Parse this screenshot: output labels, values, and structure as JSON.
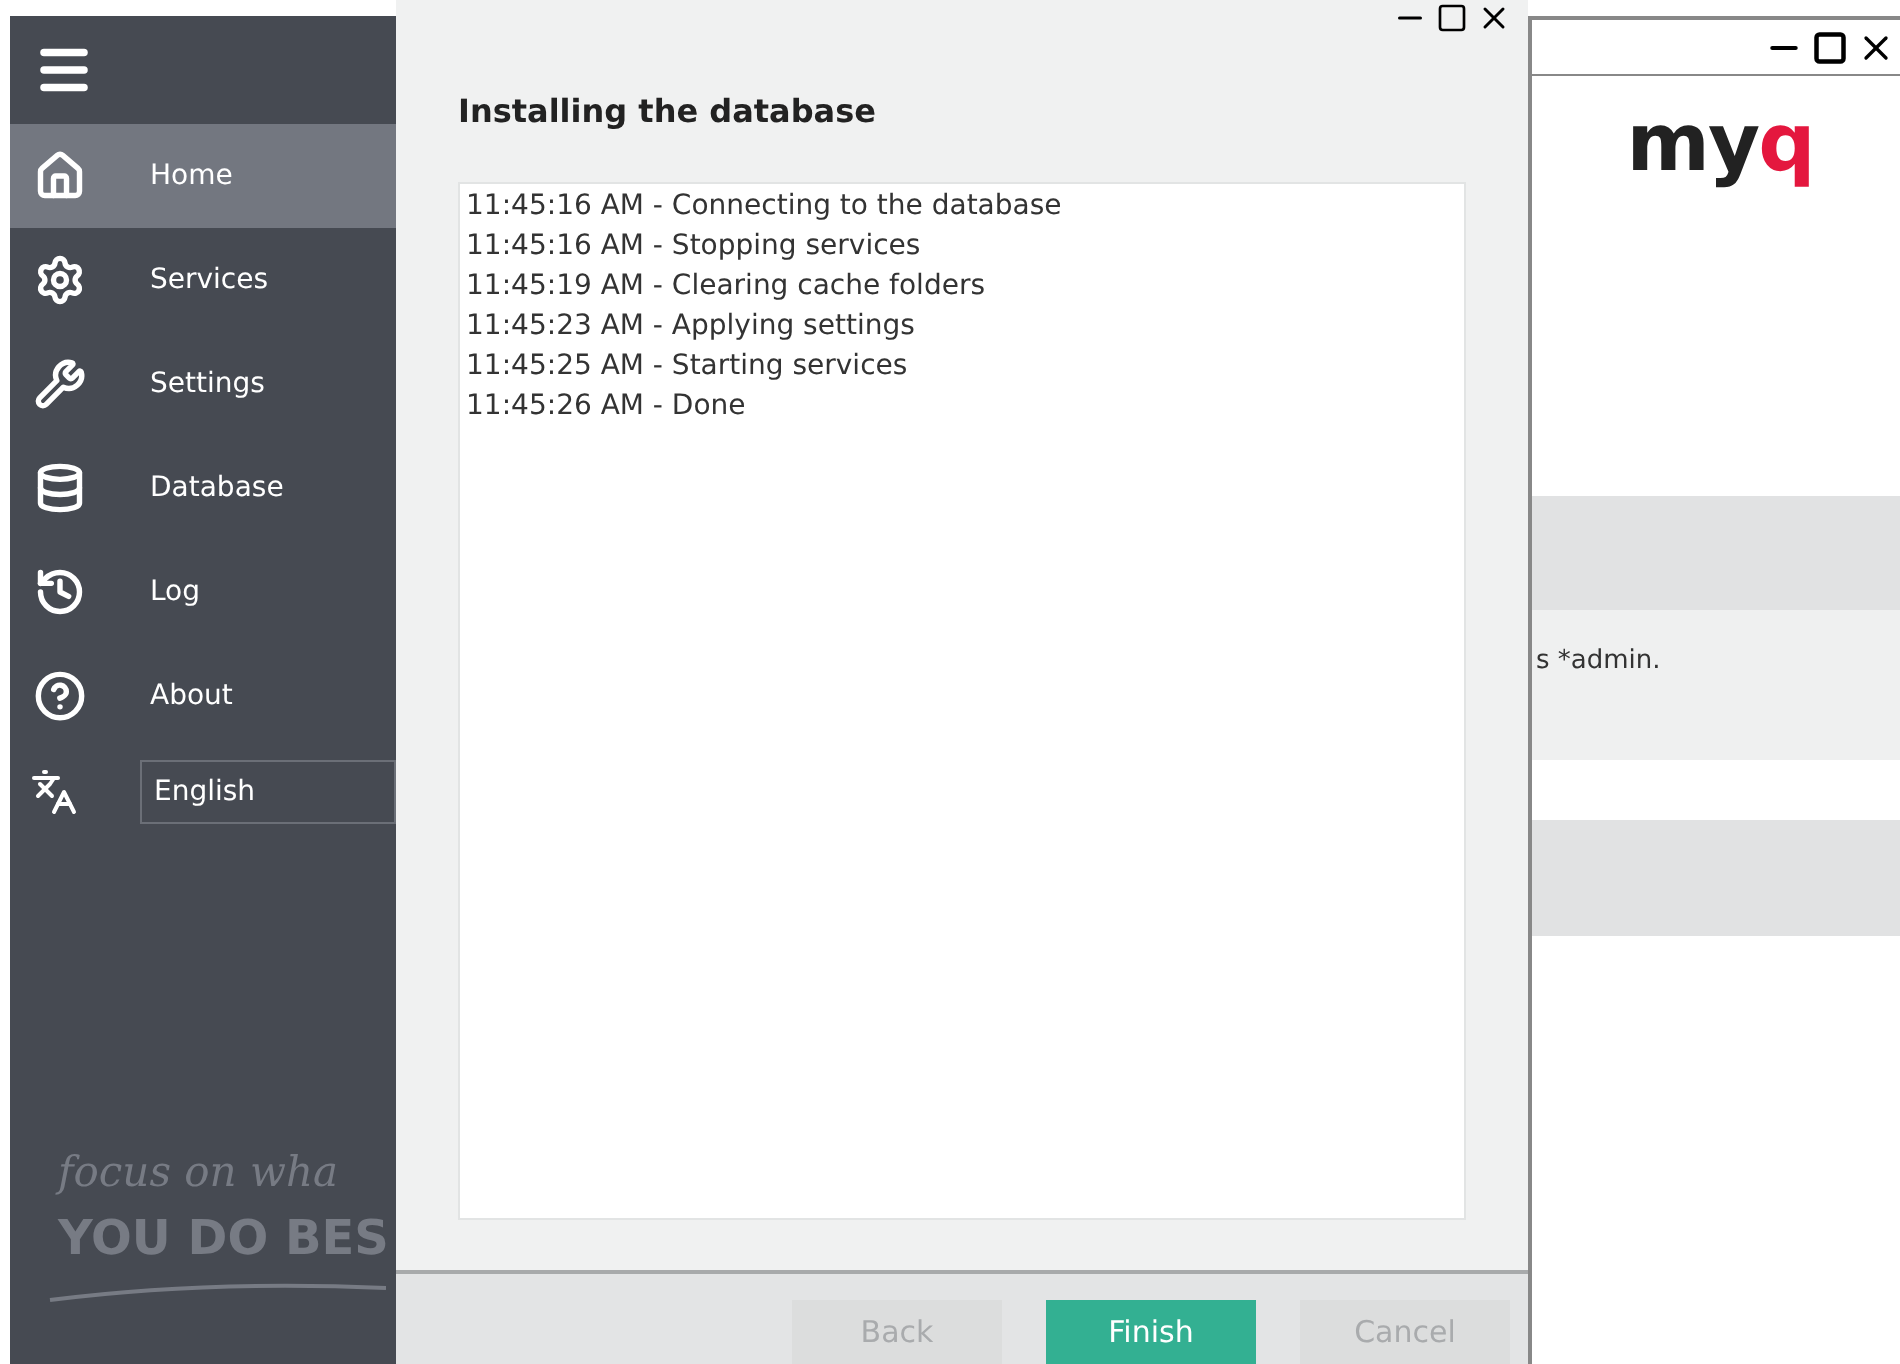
{
  "sidebar": {
    "items": [
      {
        "label": "Home",
        "selected": true
      },
      {
        "label": "Services",
        "selected": false
      },
      {
        "label": "Settings",
        "selected": false
      },
      {
        "label": "Database",
        "selected": false
      },
      {
        "label": "Log",
        "selected": false
      },
      {
        "label": "About",
        "selected": false
      }
    ],
    "language": {
      "value": "English"
    },
    "tagline": {
      "line_1": "focus on wha",
      "line_2": "YOU DO BES"
    }
  },
  "dialog": {
    "title": "Installing the database",
    "log_lines": [
      "11:45:16 AM - Connecting to the database",
      "11:45:16 AM - Stopping services",
      "11:45:19 AM - Clearing cache folders",
      "11:45:23 AM - Applying settings",
      "11:45:25 AM - Starting services",
      "11:45:26 AM - Done"
    ],
    "buttons": [
      {
        "label": "Back",
        "kind": "secondary",
        "disabled": true
      },
      {
        "label": "Finish",
        "kind": "primary",
        "disabled": false
      },
      {
        "label": "Cancel",
        "kind": "secondary",
        "disabled": true
      }
    ]
  },
  "background_window": {
    "logo": {
      "part_1": "my",
      "part_2": "q"
    },
    "message": "s *admin."
  }
}
